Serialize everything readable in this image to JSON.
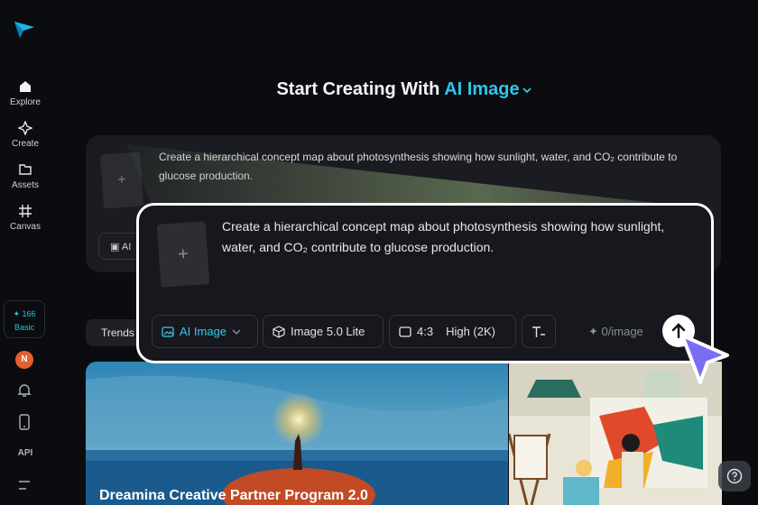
{
  "sidebar": {
    "items": [
      {
        "label": "Explore",
        "icon": "home-icon"
      },
      {
        "label": "Create",
        "icon": "sparkle-icon"
      },
      {
        "label": "Assets",
        "icon": "folder-icon"
      },
      {
        "label": "Canvas",
        "icon": "canvas-grid-icon"
      }
    ],
    "credits_count": "166",
    "plan": "Basic",
    "avatar_initial": "N",
    "api_label": "API"
  },
  "heading": {
    "prefix": "Start Creating With",
    "accent": "AI Image"
  },
  "background_card": {
    "prompt": "Create a hierarchical concept map about photosynthesis showing how sunlight, water, and CO₂ contribute to glucose production.",
    "chip_label": "AI"
  },
  "trends_label": "Trends",
  "hero": {
    "title": "Dreamina Creative Partner Program 2.0"
  },
  "prompt_box": {
    "thumb_plus": "+",
    "prompt": "Create a hierarchical concept map about photosynthesis showing how sunlight, water, and CO₂ contribute to glucose production.",
    "mode_label": "AI Image",
    "model_label": "Image 5.0 Lite",
    "ratio_label": "4:3",
    "quality_label": "High (2K)",
    "cost_label": "0/image"
  },
  "colors": {
    "accent": "#2fc6ea",
    "cursor": "#7b6cf6",
    "avatar": "#e2612c"
  }
}
